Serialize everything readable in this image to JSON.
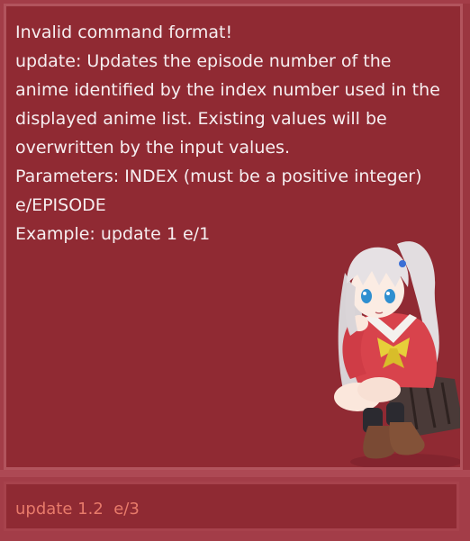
{
  "result_display": {
    "message": "Invalid command format!\nupdate: Updates the episode number of the anime identified by the index number used in the displayed anime list. Existing values will be overwritten by the input values.\nParameters: INDEX (must be a positive integer) e/EPISODE\nExample: update 1 e/1"
  },
  "mascot": {
    "icon": "anime-girl-mascot"
  },
  "command_box": {
    "value": "update 1.2  e/3"
  },
  "colors": {
    "background": "#a33d48",
    "panel": "#902a33",
    "text": "#f6eef0",
    "command_text": "#e87a6a"
  }
}
